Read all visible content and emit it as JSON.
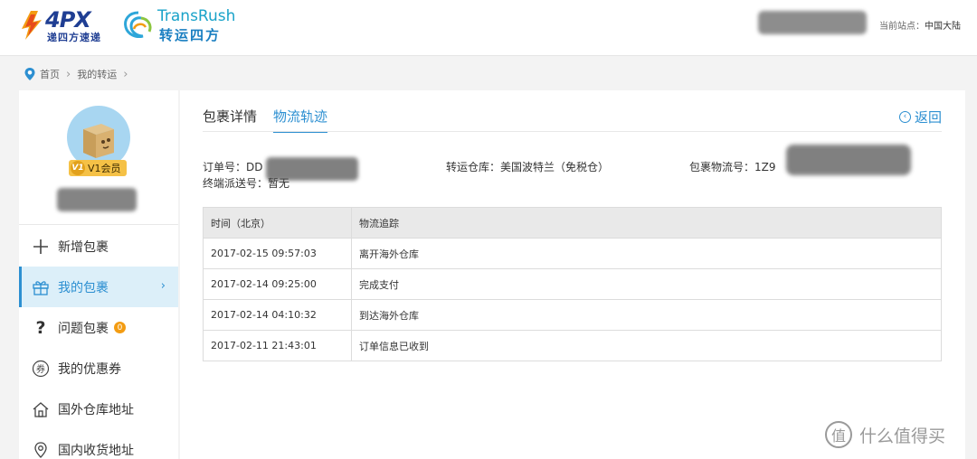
{
  "header": {
    "brand_4px": "4PX",
    "brand_4px_sub": "递四方速递",
    "brand_tr_en": "TransRush",
    "brand_tr_cn": "转运四方",
    "current_site_label": "当前站点：",
    "current_site_value": "中国大陆"
  },
  "breadcrumb": {
    "home": "首页",
    "current": "我的转运"
  },
  "sidebar": {
    "vip_badge": "V1",
    "vip_label": "V1会员",
    "menu": [
      {
        "label": "新增包裹",
        "icon": "plus-icon"
      },
      {
        "label": "我的包裹",
        "icon": "gift-icon"
      },
      {
        "label": "问题包裹",
        "icon": "question-icon",
        "badge": "0"
      },
      {
        "label": "我的优惠券",
        "icon": "coupon-icon"
      },
      {
        "label": "国外仓库地址",
        "icon": "house-icon"
      },
      {
        "label": "国内收货地址",
        "icon": "location-pin-icon"
      }
    ]
  },
  "main": {
    "tabs": [
      "包裹详情",
      "物流轨迹"
    ],
    "active_tab": "物流轨迹",
    "back_label": "返回",
    "order_label": "订单号：",
    "order_value": "DD",
    "warehouse_label": "转运仓库：",
    "warehouse_value": "美国波特兰（免税仓）",
    "tracking_label": "包裹物流号：",
    "tracking_value": "1Z9",
    "final_label": "终端派送号：",
    "final_value": "暂无",
    "table": {
      "headers": [
        "时间（北京）",
        "物流追踪"
      ],
      "rows": [
        [
          "2017-02-15 09:57:03",
          "离开海外仓库"
        ],
        [
          "2017-02-14 09:25:00",
          "完成支付"
        ],
        [
          "2017-02-14 04:10:32",
          "到达海外仓库"
        ],
        [
          "2017-02-11 21:43:01",
          "订单信息已收到"
        ]
      ]
    }
  },
  "watermark": {
    "glyph": "值",
    "text": "什么值得买"
  },
  "colors": {
    "accent": "#2c8fd1",
    "brand_blue": "#1f3e93",
    "badge": "#f39c12",
    "vip": "#f5c146"
  }
}
